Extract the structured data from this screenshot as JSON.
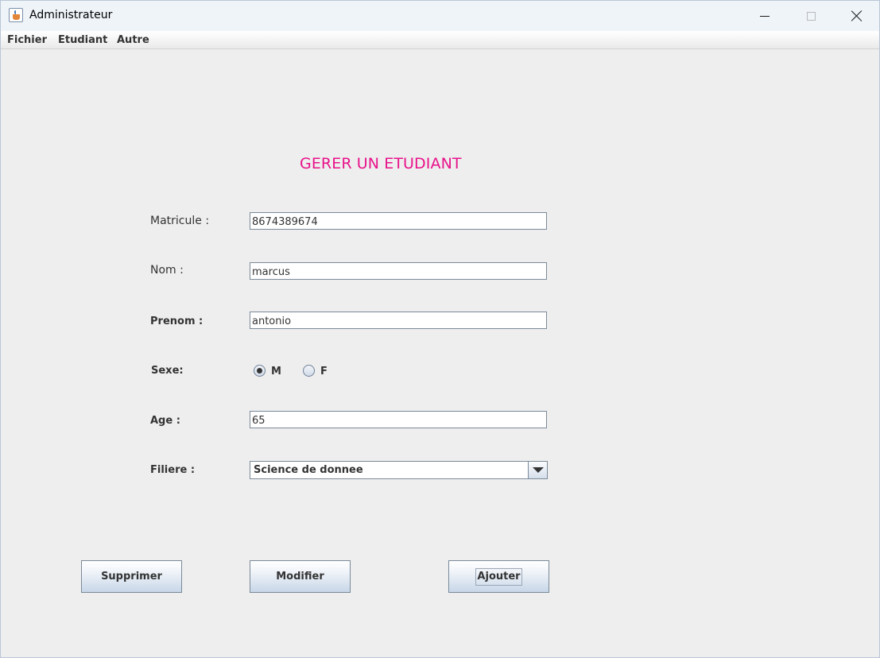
{
  "window": {
    "title": "Administrateur",
    "icon": "java-cup-icon"
  },
  "menubar": {
    "items": [
      "Fichier",
      "Etudiant",
      "Autre"
    ]
  },
  "form": {
    "title": "GERER UN ETUDIANT",
    "title_color": "#e8128a",
    "matricule": {
      "label": "Matricule :",
      "value": "8674389674"
    },
    "nom": {
      "label": "Nom :",
      "value": "marcus"
    },
    "prenom": {
      "label": "Prenom :",
      "value": "antonio"
    },
    "sexe": {
      "label": "Sexe:",
      "options": [
        "M",
        "F"
      ],
      "selected": "M"
    },
    "age": {
      "label": "Age :",
      "value": "65"
    },
    "filiere": {
      "label": "Filiere :",
      "selected": "Science de donnee"
    }
  },
  "buttons": {
    "supprimer": "Supprimer",
    "modifier": "Modifier",
    "ajouter": "Ajouter"
  }
}
